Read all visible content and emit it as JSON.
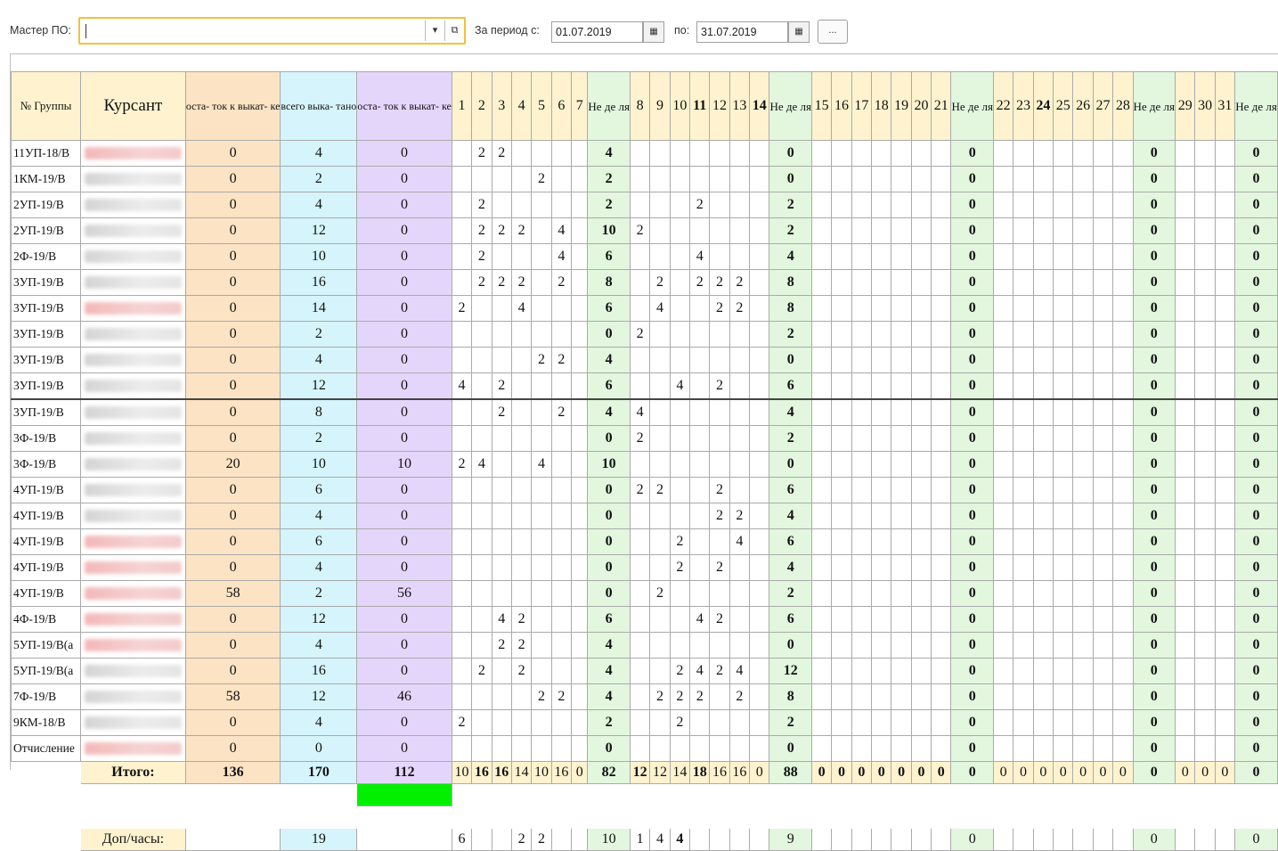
{
  "toolbar": {
    "master_label": "Мастер ПО:",
    "master_value": "",
    "period_label": "За период с:",
    "date_from": "01.07.2019",
    "to_label": "по:",
    "date_to": "31.07.2019",
    "dots_label": "..."
  },
  "header": {
    "group": "№ Группы",
    "cadet": "Курсант",
    "remaining_before": "оста- ток к выкат- ке",
    "total_driven": "всего выка- тано",
    "remaining_after": "оста- ток к выкат- ке",
    "week_label": "Не де ля"
  },
  "days": [
    1,
    2,
    3,
    4,
    5,
    6,
    7,
    8,
    9,
    10,
    11,
    12,
    13,
    14,
    15,
    16,
    17,
    18,
    19,
    20,
    21,
    22,
    23,
    24,
    25,
    26,
    27,
    28,
    29,
    30,
    31
  ],
  "rows": [
    {
      "group": "11УП-18/В",
      "pink": true,
      "before": "0",
      "total": "4",
      "after": "0",
      "days": {
        "2": "2",
        "3": "2"
      },
      "weeks": [
        "4",
        "0",
        "0",
        "0",
        "0"
      ]
    },
    {
      "group": "1КМ-19/В",
      "pink": false,
      "before": "0",
      "total": "2",
      "after": "0",
      "days": {
        "5": "2"
      },
      "weeks": [
        "2",
        "0",
        "0",
        "0",
        "0"
      ]
    },
    {
      "group": "2УП-19/В",
      "pink": false,
      "before": "0",
      "total": "4",
      "after": "0",
      "days": {
        "2": "2",
        "11": "2"
      },
      "weeks": [
        "2",
        "2",
        "0",
        "0",
        "0"
      ]
    },
    {
      "group": "2УП-19/В",
      "pink": false,
      "before": "0",
      "total": "12",
      "after": "0",
      "days": {
        "2": "2",
        "3": "2",
        "4": "2",
        "6": "4",
        "8": "2"
      },
      "weeks": [
        "10",
        "2",
        "0",
        "0",
        "0"
      ]
    },
    {
      "group": "2Ф-19/В",
      "pink": false,
      "before": "0",
      "total": "10",
      "after": "0",
      "days": {
        "2": "2",
        "6": "4",
        "11": "4"
      },
      "weeks": [
        "6",
        "4",
        "0",
        "0",
        "0"
      ]
    },
    {
      "group": "3УП-19/В",
      "pink": false,
      "before": "0",
      "total": "16",
      "after": "0",
      "days": {
        "2": "2",
        "3": "2",
        "4": "2",
        "6": "2",
        "9": "2",
        "11": "2",
        "12": "2",
        "13": "2"
      },
      "weeks": [
        "8",
        "8",
        "0",
        "0",
        "0"
      ]
    },
    {
      "group": "3УП-19/В",
      "pink": true,
      "before": "0",
      "total": "14",
      "after": "0",
      "days": {
        "1": "2",
        "4": "4",
        "9": "4",
        "12": "2",
        "13": "2"
      },
      "weeks": [
        "6",
        "8",
        "0",
        "0",
        "0"
      ]
    },
    {
      "group": "3УП-19/В",
      "pink": false,
      "before": "0",
      "total": "2",
      "after": "0",
      "days": {
        "8": "2"
      },
      "weeks": [
        "0",
        "2",
        "0",
        "0",
        "0"
      ]
    },
    {
      "group": "3УП-19/В",
      "pink": false,
      "before": "0",
      "total": "4",
      "after": "0",
      "days": {
        "5": "2",
        "6": "2"
      },
      "weeks": [
        "4",
        "0",
        "0",
        "0",
        "0"
      ]
    },
    {
      "group": "3УП-19/В",
      "pink": false,
      "before": "0",
      "total": "12",
      "after": "0",
      "days": {
        "1": "4",
        "3": "2",
        "10": "4",
        "12": "2"
      },
      "weeks": [
        "6",
        "6",
        "0",
        "0",
        "0"
      ]
    },
    {
      "group": "3УП-19/В",
      "pink": false,
      "thick": true,
      "before": "0",
      "total": "8",
      "after": "0",
      "days": {
        "3": "2",
        "6": "2",
        "8": "4"
      },
      "weeks": [
        "4",
        "4",
        "0",
        "0",
        "0"
      ]
    },
    {
      "group": "3Ф-19/В",
      "pink": false,
      "before": "0",
      "total": "2",
      "after": "0",
      "days": {
        "8": "2"
      },
      "weeks": [
        "0",
        "2",
        "0",
        "0",
        "0"
      ]
    },
    {
      "group": "3Ф-19/В",
      "pink": false,
      "before": "20",
      "total": "10",
      "after": "10",
      "days": {
        "1": "2",
        "2": "4",
        "5": "4"
      },
      "weeks": [
        "10",
        "0",
        "0",
        "0",
        "0"
      ]
    },
    {
      "group": "4УП-19/В",
      "pink": false,
      "before": "0",
      "total": "6",
      "after": "0",
      "days": {
        "8": "2",
        "9": "2",
        "12": "2"
      },
      "weeks": [
        "0",
        "6",
        "0",
        "0",
        "0"
      ]
    },
    {
      "group": "4УП-19/В",
      "pink": false,
      "before": "0",
      "total": "4",
      "after": "0",
      "days": {
        "12": "2",
        "13": "2"
      },
      "weeks": [
        "0",
        "4",
        "0",
        "0",
        "0"
      ]
    },
    {
      "group": "4УП-19/В",
      "pink": true,
      "before": "0",
      "total": "6",
      "after": "0",
      "days": {
        "10": "2",
        "13": "4"
      },
      "weeks": [
        "0",
        "6",
        "0",
        "0",
        "0"
      ]
    },
    {
      "group": "4УП-19/В",
      "pink": true,
      "before": "0",
      "total": "4",
      "after": "0",
      "days": {
        "10": "2",
        "12": "2"
      },
      "weeks": [
        "0",
        "4",
        "0",
        "0",
        "0"
      ]
    },
    {
      "group": "4УП-19/В",
      "pink": true,
      "before": "58",
      "total": "2",
      "after": "56",
      "days": {
        "9": "2"
      },
      "weeks": [
        "0",
        "2",
        "0",
        "0",
        "0"
      ]
    },
    {
      "group": "4Ф-19/В",
      "pink": true,
      "before": "0",
      "total": "12",
      "after": "0",
      "days": {
        "3": "4",
        "4": "2",
        "11": "4",
        "12": "2"
      },
      "weeks": [
        "6",
        "6",
        "0",
        "0",
        "0"
      ]
    },
    {
      "group": "5УП-19/В(а",
      "pink": true,
      "before": "0",
      "total": "4",
      "after": "0",
      "days": {
        "3": "2",
        "4": "2"
      },
      "weeks": [
        "4",
        "0",
        "0",
        "0",
        "0"
      ]
    },
    {
      "group": "5УП-19/В(а",
      "pink": false,
      "before": "0",
      "total": "16",
      "after": "0",
      "days": {
        "2": "2",
        "4": "2",
        "10": "2",
        "11": "4",
        "12": "2",
        "13": "4"
      },
      "weeks": [
        "4",
        "12",
        "0",
        "0",
        "0"
      ]
    },
    {
      "group": "7Ф-19/В",
      "pink": false,
      "before": "58",
      "total": "12",
      "after": "46",
      "days": {
        "5": "2",
        "6": "2",
        "9": "2",
        "10": "2",
        "11": "2",
        "13": "2"
      },
      "weeks": [
        "4",
        "8",
        "0",
        "0",
        "0"
      ]
    },
    {
      "group": "9КМ-18/В",
      "pink": false,
      "before": "0",
      "total": "4",
      "after": "0",
      "days": {
        "1": "2",
        "10": "2"
      },
      "weeks": [
        "2",
        "2",
        "0",
        "0",
        "0"
      ]
    },
    {
      "group": "Отчисление",
      "pink": true,
      "before": "0",
      "total": "0",
      "after": "0",
      "days": {},
      "weeks": [
        "0",
        "0",
        "0",
        "0",
        "0"
      ]
    }
  ],
  "totals": {
    "label": "Итого:",
    "before": "136",
    "total": "170",
    "after": "112",
    "days": {
      "1": "10",
      "2": "16",
      "3": "16",
      "4": "14",
      "5": "10",
      "6": "16",
      "7": "0",
      "8": "12",
      "9": "12",
      "10": "14",
      "11": "18",
      "12": "16",
      "13": "16",
      "14": "0",
      "15": "0",
      "16": "0",
      "17": "0",
      "18": "0",
      "19": "0",
      "20": "0",
      "21": "0",
      "22": "0",
      "23": "0",
      "24": "0",
      "25": "0",
      "26": "0",
      "27": "0",
      "28": "0",
      "29": "0",
      "30": "0",
      "31": "0"
    },
    "weeks": [
      "82",
      "88",
      "0",
      "0",
      "0"
    ]
  },
  "extra": {
    "label": "Доп/часы:",
    "before": "",
    "total": "19",
    "after": "",
    "days": {
      "1": "6",
      "4": "2",
      "5": "2",
      "8": "1",
      "9": "4",
      "10": "4"
    },
    "weeks": [
      "10",
      "9",
      "0",
      "0",
      "0"
    ]
  },
  "colors": {
    "orange": "#fbe3c4",
    "blue": "#d5f4fb",
    "purple": "#e4d6fb",
    "week": "#e2f7de",
    "tan": "#fff3cf",
    "green": "#00f000",
    "focus": "#f2c13c"
  }
}
